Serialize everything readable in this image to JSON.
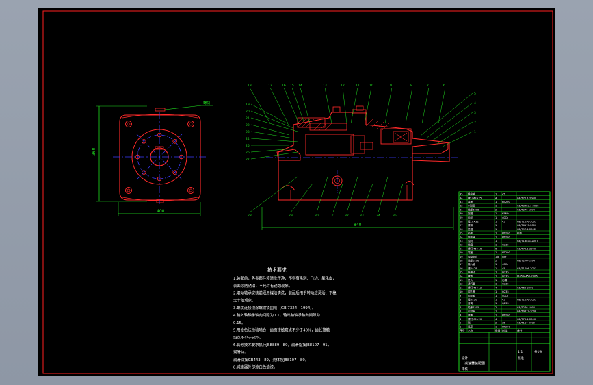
{
  "colors": {
    "viewport_bg": "#97a0ad",
    "sheet_bg": "#000000",
    "frame": "#ff2020",
    "geometry": "#ff2a2a",
    "dimension": "#20e020",
    "centerline": "#3c3cff",
    "table": "#20e020",
    "text": "#ffffff"
  },
  "left_view": {
    "dim_height": "360",
    "dim_width": "400",
    "tag_label": "螺钉"
  },
  "section_view": {
    "top_leaders": [
      "13",
      "12",
      "16",
      "15",
      "14",
      "13",
      "12",
      "11",
      "10",
      "9",
      "8",
      "7",
      "6"
    ],
    "left_leaders": [
      "19",
      "20",
      "21",
      "22",
      "23",
      "24",
      "25",
      "26",
      "27"
    ],
    "right_leaders": [
      "5",
      "4",
      "3",
      "2",
      "1"
    ],
    "bottom_leaders": [
      "28",
      "29",
      "30",
      "31",
      "32",
      "33",
      "34",
      "35"
    ],
    "overall_dim": "840"
  },
  "tech_notes": {
    "title": "技术要求",
    "lines": [
      "1.装配前，各零部件须清洗干净，不得有毛刺、飞边、氧化皮，",
      "  表面涂防锈油，不允许有锈蚀现象。",
      "2.滚动轴承安装前须用煤油清洗，装配后用手转动应灵活、平稳",
      "  无卡阻现象。",
      "3.螺纹连接须涂螺纹锁固剂（GB 7324—1994）。",
      "4.输入轴轴承轴向间隙为0.1，输出轴轴承轴向间隙为",
      "  0.15。",
      "5.用涂色法检验啮合，齿面接触斑点不少于40%，齿长接触",
      "  斑点不小于50%。",
      "6.其他技术要求执行JB8889—89，润滑脂按JB8107—91，",
      "  润滑油。",
      "  润滑油按GB443—89，壳体按JB8107—89。",
      "8.减速器外部涂白色油漆。"
    ]
  },
  "parts_table": {
    "rows": [
      [
        "35",
        "输出轴",
        "1",
        "45",
        ""
      ],
      [
        "34",
        "螺钉M8×25",
        "4",
        "",
        "GB/T70.1-2000"
      ],
      [
        "33",
        "端盖",
        "1",
        "HT200",
        ""
      ],
      [
        "32",
        "O形圈",
        "1",
        "",
        "GB/T3452.1-2005"
      ],
      [
        "31",
        "轴承6208",
        "2",
        "",
        "GB/T276-1994"
      ],
      [
        "30",
        "挡圈",
        "1",
        "65Mn",
        ""
      ],
      [
        "29",
        "齿轮",
        "1",
        "40Cr",
        ""
      ],
      [
        "28",
        "键10×32",
        "1",
        "45",
        "GB/T1096-2003"
      ],
      [
        "27",
        "螺母",
        "1",
        "",
        "GB/T6170-2000"
      ],
      [
        "26",
        "垫圈",
        "1",
        "",
        "GB/T97.1-2002"
      ],
      [
        "25",
        "箱体",
        "1",
        "HT200",
        "组件"
      ],
      [
        "24",
        "轴承座",
        "1",
        "HT200",
        ""
      ],
      [
        "23",
        "油封",
        "1",
        "",
        "GB/T13871-2007"
      ],
      [
        "22",
        "轴套",
        "1",
        "Q235",
        ""
      ],
      [
        "21",
        "螺钉M6×16",
        "6",
        "",
        "GB/T70.1-2000"
      ],
      [
        "20",
        "端盖",
        "1",
        "HT200",
        ""
      ],
      [
        "19",
        "调整垫片",
        "1组",
        "08F",
        ""
      ],
      [
        "18",
        "轴承6206",
        "2",
        "",
        "GB/T276-1994"
      ],
      [
        "17",
        "输入轴",
        "1",
        "40Cr",
        ""
      ],
      [
        "16",
        "键8×28",
        "1",
        "45",
        "GB/T1096-2003"
      ],
      [
        "15",
        "挡油环",
        "1",
        "Q235",
        ""
      ],
      [
        "14",
        "螺塞",
        "1",
        "Q235",
        "JB/ZQ4450-2006"
      ],
      [
        "13",
        "垫片",
        "1",
        "石棉",
        ""
      ],
      [
        "12",
        "透气塞",
        "1",
        "Q235",
        ""
      ],
      [
        "11",
        "螺钉M5×12",
        "4",
        "",
        "GB/T65-2000"
      ],
      [
        "10",
        "视孔盖",
        "1",
        "Q235",
        ""
      ],
      [
        "9",
        "齿轮轴",
        "1",
        "40Cr",
        ""
      ],
      [
        "8",
        "键6×20",
        "1",
        "45",
        "GB/T1096-2003"
      ],
      [
        "7",
        "套筒",
        "1",
        "Q235",
        ""
      ],
      [
        "6",
        "轴承6205",
        "2",
        "",
        "GB/T276-1994"
      ],
      [
        "5",
        "密封圈",
        "1",
        "",
        "GB/T9877-2008"
      ],
      [
        "4",
        "端盖",
        "1",
        "HT200",
        ""
      ],
      [
        "3",
        "螺钉M6×20",
        "4",
        "",
        "GB/T70.1-2000"
      ],
      [
        "2",
        "销",
        "2",
        "35",
        "GB/T117-2000"
      ],
      [
        "1",
        "底座",
        "1",
        "HT200",
        ""
      ]
    ],
    "header": [
      "序号",
      "名称",
      "数量",
      "材料",
      "备注"
    ],
    "title_block": {
      "name": "减速器装配图",
      "scale": "1:1",
      "sheet": "共1张",
      "drawn": "设计",
      "checked": "审核",
      "approved": "批准"
    }
  }
}
